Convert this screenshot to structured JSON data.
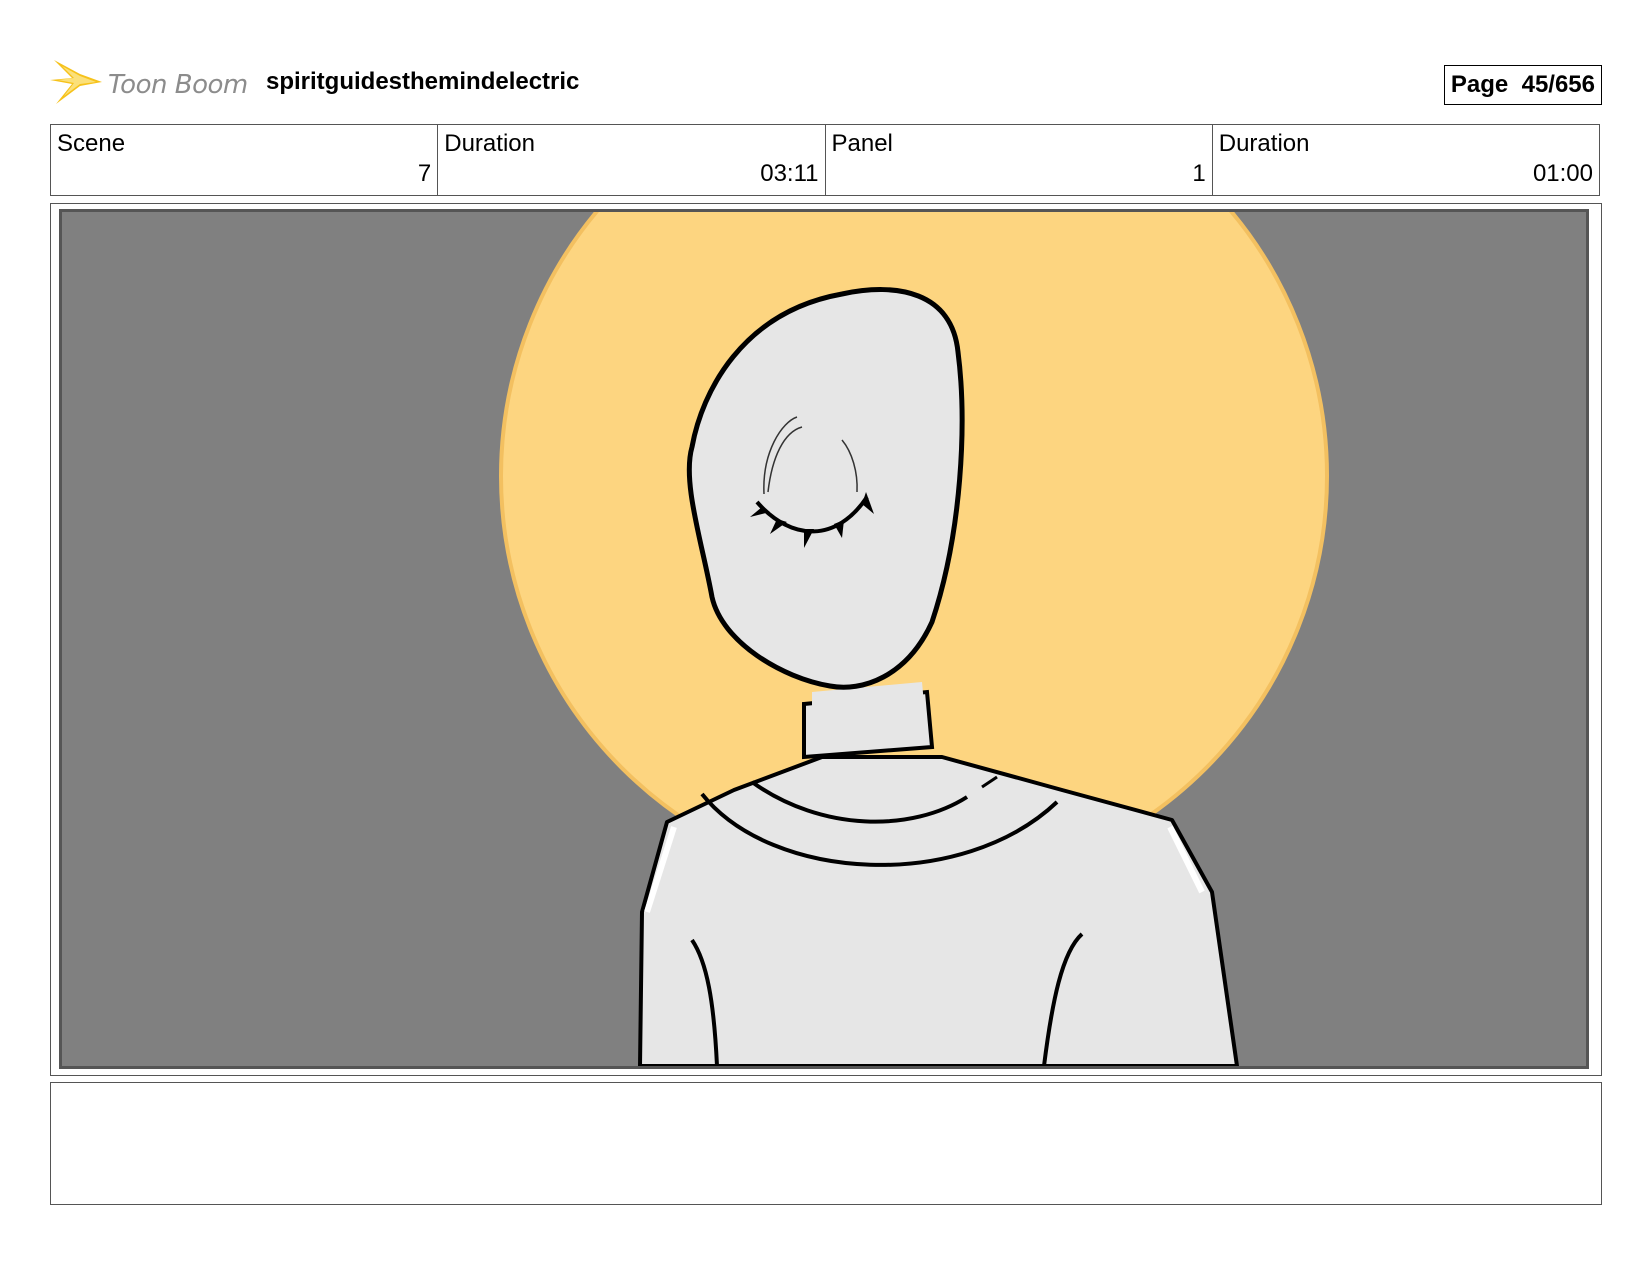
{
  "header": {
    "logo_text": "Toon Boom",
    "project_title": "spiritguidesthemindelectric",
    "page_label": "Page",
    "page_number": "45/656"
  },
  "info": {
    "scene_label": "Scene",
    "scene_value": "7",
    "scene_duration_label": "Duration",
    "scene_duration_value": "03:11",
    "panel_label": "Panel",
    "panel_value": "1",
    "panel_duration_label": "Duration",
    "panel_duration_value": "01:00"
  },
  "colors": {
    "background_gray": "#808080",
    "halo_yellow": "#fdd580",
    "figure_fill": "#e6e6e6",
    "logo_yellow": "#f6c21a"
  },
  "icons": {
    "logo": "toon-boom-star-icon"
  },
  "notes": {
    "text": ""
  }
}
